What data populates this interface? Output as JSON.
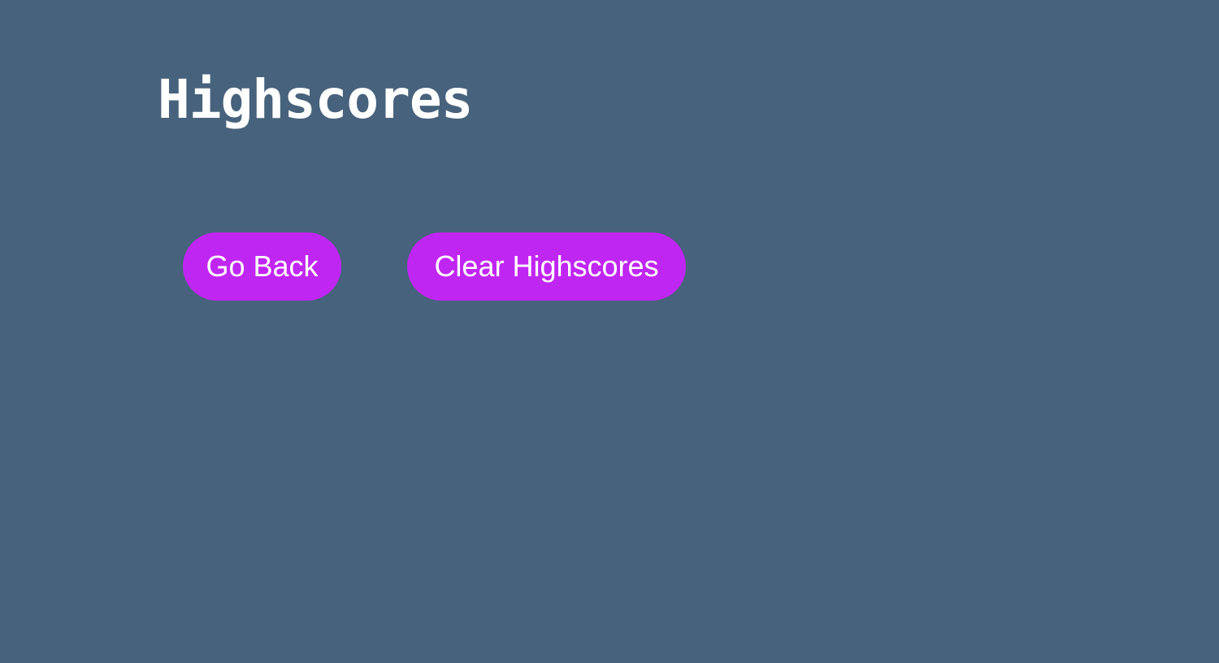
{
  "page": {
    "title": "Highscores"
  },
  "actions": {
    "go_back_label": "Go Back",
    "clear_label": "Clear Highscores"
  },
  "colors": {
    "background": "#47627c",
    "button_accent": "#c026f2",
    "text": "#ffffff"
  }
}
